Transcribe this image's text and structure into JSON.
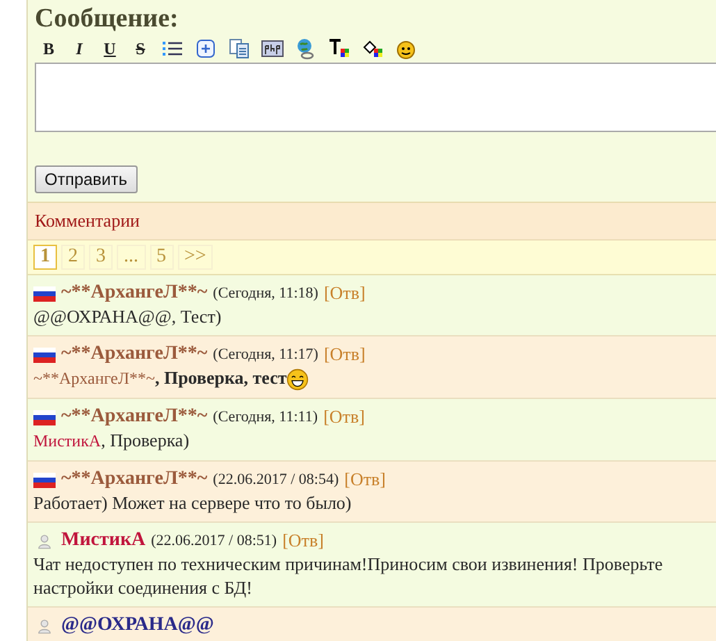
{
  "form": {
    "title": "Сообщение:",
    "toolbar": [
      {
        "kind": "bold",
        "label": "B"
      },
      {
        "kind": "italic",
        "label": "I"
      },
      {
        "kind": "underline",
        "label": "U"
      },
      {
        "kind": "strike",
        "label": "S"
      },
      {
        "kind": "list"
      },
      {
        "kind": "plus"
      },
      {
        "kind": "copy"
      },
      {
        "kind": "php"
      },
      {
        "kind": "link"
      },
      {
        "kind": "textcolor"
      },
      {
        "kind": "fillcolor"
      },
      {
        "kind": "smiley"
      }
    ],
    "submit": "Отправить"
  },
  "comments": {
    "title": "Комментарии",
    "pages": [
      {
        "label": "1",
        "selected": true
      },
      {
        "label": "2",
        "selected": false
      },
      {
        "label": "3",
        "selected": false
      },
      {
        "label": "...",
        "selected": false
      },
      {
        "label": "5",
        "selected": false
      },
      {
        "label": ">>",
        "selected": false
      }
    ],
    "items": [
      {
        "kind": "flag",
        "author": "~**АрхангеЛ**~",
        "color": "#9b5a3c",
        "time": "(Сегодня, 11:18)",
        "reply": "[Отв]",
        "body": [
          {
            "kind": "text",
            "text": "@@ОХРАНА@@, Тест)"
          }
        ]
      },
      {
        "kind": "flag",
        "author": "~**АрхангеЛ**~",
        "color": "#9b5a3c",
        "time": "(Сегодня, 11:17)",
        "reply": "[Отв]",
        "body": [
          {
            "kind": "mention",
            "text": "~**АрхангеЛ**~",
            "color": "#9b5a3c"
          },
          {
            "kind": "bold",
            "text": ", Проверка, тест"
          },
          {
            "kind": "smiley"
          }
        ]
      },
      {
        "kind": "flag",
        "author": "~**АрхангеЛ**~",
        "color": "#9b5a3c",
        "time": "(Сегодня, 11:11)",
        "reply": "[Отв]",
        "body": [
          {
            "kind": "mention",
            "text": "МистикА",
            "color": "#c0143c"
          },
          {
            "kind": "text",
            "text": ", Проверка)"
          }
        ]
      },
      {
        "kind": "flag",
        "author": "~**АрхангеЛ**~",
        "color": "#9b5a3c",
        "time": "(22.06.2017 / 08:54)",
        "reply": "[Отв]",
        "body": [
          {
            "kind": "text",
            "text": "Работает) Может на сервере что то было)"
          }
        ]
      },
      {
        "kind": "user",
        "author": "МистикА",
        "color": "#c0143c",
        "time": "(22.06.2017 / 08:51)",
        "reply": "[Отв]",
        "body": [
          {
            "kind": "text",
            "text": "Чат недоступен по техническим причинам!Приносим свои извинения! Проверьте настройки соединения с БД!"
          }
        ]
      },
      {
        "kind": "user",
        "author": "@@ОХРАНА@@",
        "color": "#2a2a8a"
      }
    ]
  }
}
